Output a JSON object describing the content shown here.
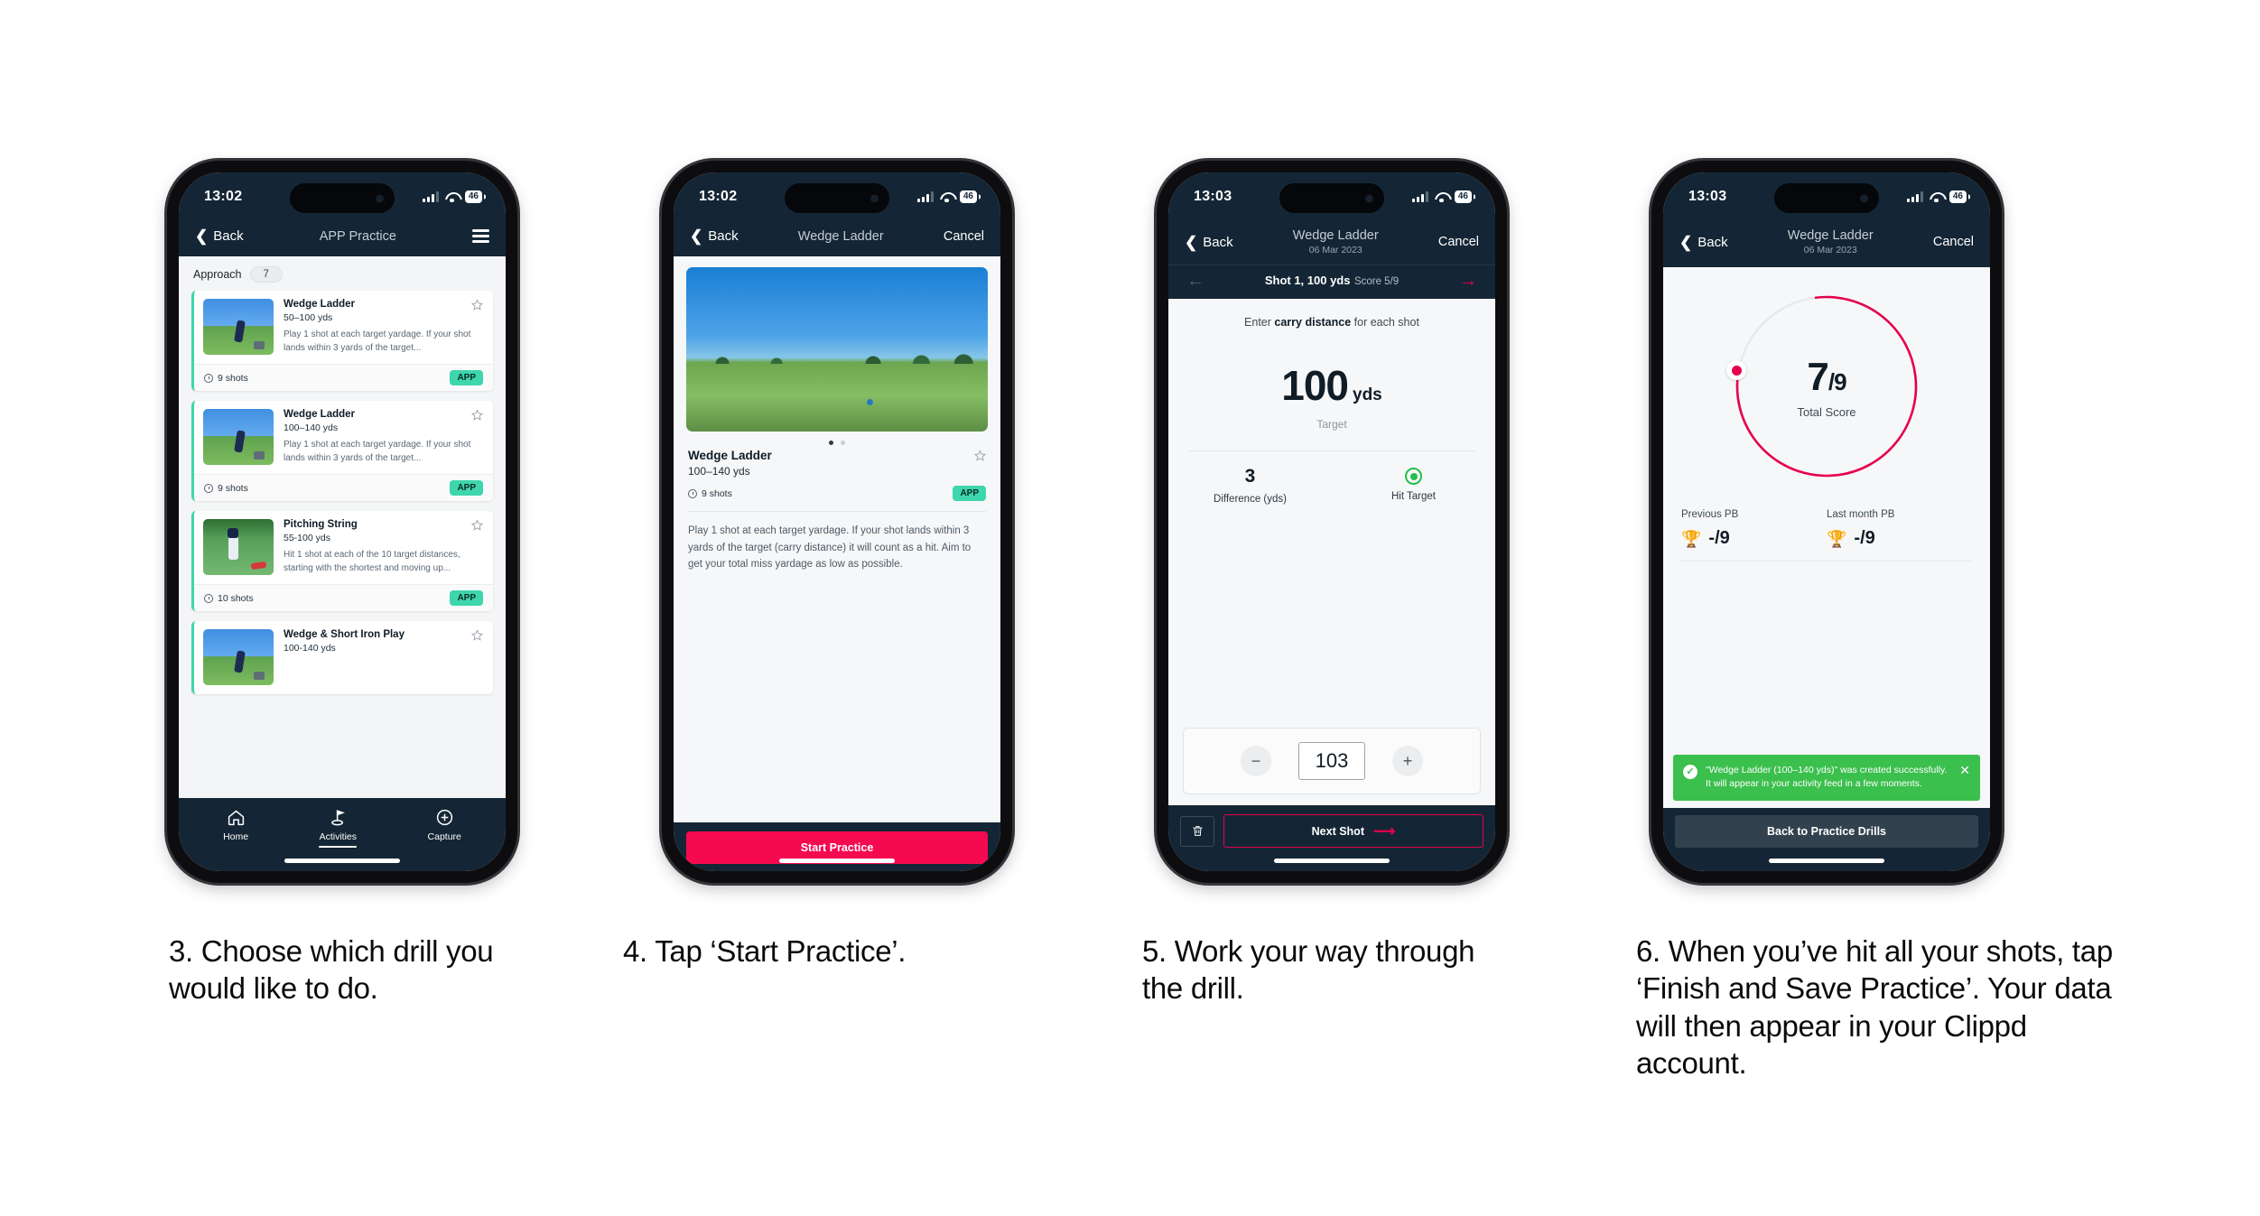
{
  "phones": [
    {
      "id": "phone-app-practice",
      "status": {
        "time": "13:02",
        "battery": "46"
      },
      "nav": {
        "back": "Back",
        "title": "APP Practice"
      },
      "filter": {
        "label": "Approach",
        "count": "7"
      },
      "cards": [
        {
          "title": "Wedge Ladder",
          "range": "50–100 yds",
          "desc": "Play 1 shot at each target yardage. If your shot lands within 3 yards of the target...",
          "shots": "9 shots",
          "badge": "APP"
        },
        {
          "title": "Wedge Ladder",
          "range": "100–140 yds",
          "desc": "Play 1 shot at each target yardage. If your shot lands within 3 yards of the target...",
          "shots": "9 shots",
          "badge": "APP"
        },
        {
          "title": "Pitching String",
          "range": "55-100 yds",
          "desc": "Hit 1 shot at each of the 10 target distances, starting with the shortest and moving up...",
          "shots": "10 shots",
          "badge": "APP"
        },
        {
          "title": "Wedge & Short Iron Play",
          "range": "100-140 yds",
          "desc": "",
          "shots": "",
          "badge": ""
        }
      ],
      "tabs": [
        {
          "label": "Home",
          "icon": "home-icon"
        },
        {
          "label": "Activities",
          "icon": "flag-icon"
        },
        {
          "label": "Capture",
          "icon": "plus-circle-icon"
        }
      ]
    },
    {
      "id": "phone-drill-detail",
      "status": {
        "time": "13:02",
        "battery": "46"
      },
      "nav": {
        "back": "Back",
        "title": "Wedge Ladder",
        "cancel": "Cancel"
      },
      "detail": {
        "title": "Wedge Ladder",
        "range": "100–140 yds",
        "shots": "9 shots",
        "badge": "APP",
        "description": "Play 1 shot at each target yardage. If your shot lands within 3 yards of the target (carry distance) it will count as a hit. Aim to get your total miss yardage as low as possible."
      },
      "cta": "Start Practice"
    },
    {
      "id": "phone-shot-entry",
      "status": {
        "time": "13:03",
        "battery": "46"
      },
      "nav": {
        "back": "Back",
        "title": "Wedge Ladder",
        "subtitle": "06 Mar 2023",
        "cancel": "Cancel"
      },
      "shot_strip": {
        "title": "Shot 1, 100 yds",
        "score": "Score 5/9"
      },
      "prompt": {
        "pre": "Enter ",
        "bold": "carry distance",
        "post": " for each shot"
      },
      "target": {
        "value": "100",
        "unit": "yds",
        "caption": "Target"
      },
      "stats": [
        {
          "value": "3",
          "label": "Difference (yds)"
        },
        {
          "value": "",
          "label": "Hit Target"
        }
      ],
      "stepper": {
        "minus": "−",
        "value": "103",
        "plus": "+"
      },
      "footer": {
        "next": "Next Shot"
      }
    },
    {
      "id": "phone-summary",
      "status": {
        "time": "13:03",
        "battery": "46"
      },
      "nav": {
        "back": "Back",
        "title": "Wedge Ladder",
        "subtitle": "06 Mar 2023",
        "cancel": "Cancel"
      },
      "ring": {
        "score": "7",
        "divider": "/",
        "total": "9",
        "caption": "Total Score",
        "percent": 78,
        "color": "#e6004c"
      },
      "pbs": [
        {
          "label": "Previous PB",
          "value": "-/9"
        },
        {
          "label": "Last month PB",
          "value": "-/9"
        }
      ],
      "toast": {
        "message": "\"Wedge Ladder (100–140 yds)\" was created successfully. It will appear in your activity feed in a few moments.",
        "close": "✕"
      },
      "footer": {
        "back": "Back to Practice Drills"
      }
    }
  ],
  "captions": [
    "3. Choose which drill you would like to do.",
    "4. Tap ‘Start Practice’.",
    "5. Work your way through the drill.",
    "6. When you’ve hit all your shots, tap ‘Finish and Save Practice’. Your data will then appear in your Clippd account."
  ],
  "colors": {
    "brand_pink": "#f50a50",
    "accent_green": "#3ed6ac",
    "dark_navy": "#142635",
    "toast_green": "#3bbf4d"
  }
}
